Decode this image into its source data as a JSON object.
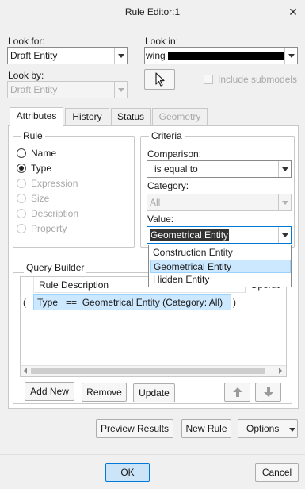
{
  "window": {
    "title": "Rule Editor:1",
    "close_glyph": "✕"
  },
  "look_for": {
    "label": "Look for:",
    "value": "Draft Entity"
  },
  "look_in": {
    "label": "Look in:",
    "value": "wing",
    "redacted_text": "████████████████████"
  },
  "look_by": {
    "label": "Look by:",
    "value": "Draft Entity"
  },
  "include_submodels": {
    "label": "Include submodels",
    "checked": false
  },
  "tabs": [
    {
      "label": "Attributes",
      "active": true
    },
    {
      "label": "History",
      "active": false
    },
    {
      "label": "Status",
      "active": false
    },
    {
      "label": "Geometry",
      "active": false,
      "disabled": true
    }
  ],
  "rule_group": {
    "title": "Rule",
    "options": [
      {
        "label": "Name",
        "selected": false,
        "enabled": true
      },
      {
        "label": "Type",
        "selected": true,
        "enabled": true
      },
      {
        "label": "Expression",
        "selected": false,
        "enabled": false
      },
      {
        "label": "Size",
        "selected": false,
        "enabled": false
      },
      {
        "label": "Description",
        "selected": false,
        "enabled": false
      },
      {
        "label": "Property",
        "selected": false,
        "enabled": false
      }
    ]
  },
  "criteria": {
    "title": "Criteria",
    "comparison_label": "Comparison:",
    "comparison_value": "is equal to",
    "category_label": "Category:",
    "category_value": "All",
    "value_label": "Value:",
    "value_value": "Geometrical Entity",
    "dropdown_options": [
      "Construction Entity",
      "Geometrical Entity",
      "Hidden Entity"
    ],
    "dropdown_selected": "Geometrical Entity"
  },
  "query_builder": {
    "title": "Query Builder",
    "columns": [
      "Rule Description",
      "Operat"
    ],
    "rows": [
      {
        "open": "(",
        "description": "Type   ==  Geometrical Entity (Category: All)",
        "close": ")"
      }
    ],
    "buttons": {
      "add_new": "Add New",
      "remove": "Remove",
      "update": "Update"
    }
  },
  "actions": {
    "preview": "Preview Results",
    "new_rule": "New Rule",
    "options": "Options"
  },
  "footer": {
    "ok": "OK",
    "cancel": "Cancel"
  },
  "colors": {
    "selection": "#cce8ff",
    "selection_border": "#99d1ff",
    "ok_button": "#cce4f7"
  }
}
